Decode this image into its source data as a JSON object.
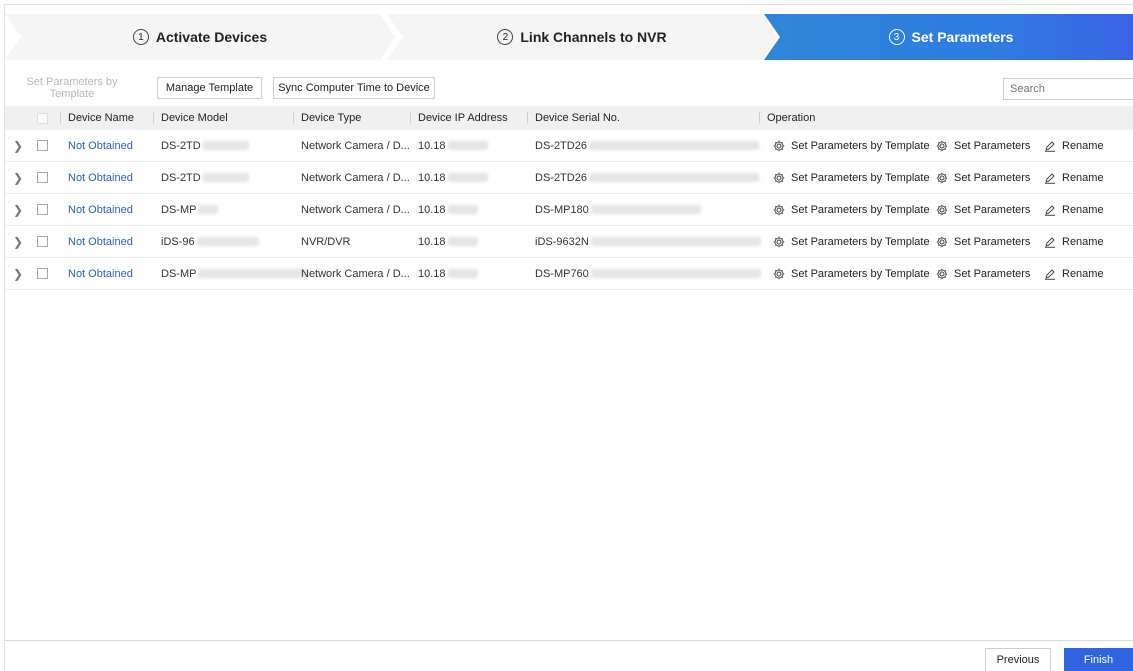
{
  "stepper": {
    "steps": [
      {
        "num": "1",
        "label": "Activate Devices"
      },
      {
        "num": "2",
        "label": "Link Channels to NVR"
      },
      {
        "num": "3",
        "label": "Set Parameters"
      }
    ],
    "active_color": "#2f7ce0"
  },
  "toolbar": {
    "set_params_template_label": "Set Parameters by Template",
    "manage_template_label": "Manage Template",
    "sync_time_label": "Sync Computer Time to Device",
    "search_placeholder": "Search"
  },
  "table": {
    "headers": {
      "device_name": "Device Name",
      "device_model": "Device Model",
      "device_type": "Device Type",
      "ip": "Device IP Address",
      "serial": "Device Serial No.",
      "operation": "Operation"
    },
    "rows": [
      {
        "name": "Not Obtained",
        "model": "DS-2TD",
        "type": "Network Camera / D...",
        "ip": "10.18",
        "serial": "DS-2TD26"
      },
      {
        "name": "Not Obtained",
        "model": "DS-2TD",
        "type": "Network Camera / D...",
        "ip": "10.18",
        "serial": "DS-2TD26"
      },
      {
        "name": "Not Obtained",
        "model": "DS-MP",
        "type": "Network Camera / D...",
        "ip": "10.18",
        "serial": "DS-MP180"
      },
      {
        "name": "Not Obtained",
        "model": "iDS-96",
        "type": "NVR/DVR",
        "ip": "10.18",
        "serial": "iDS-9632N"
      },
      {
        "name": "Not Obtained",
        "model": "DS-MP",
        "type": "Network Camera / D...",
        "ip": "10.18",
        "serial": "DS-MP760"
      }
    ],
    "operations": {
      "by_template": "Set Parameters by Template",
      "set_params": "Set Parameters",
      "rename": "Rename"
    }
  },
  "footer": {
    "previous_label": "Previous",
    "finish_label": "Finish"
  }
}
